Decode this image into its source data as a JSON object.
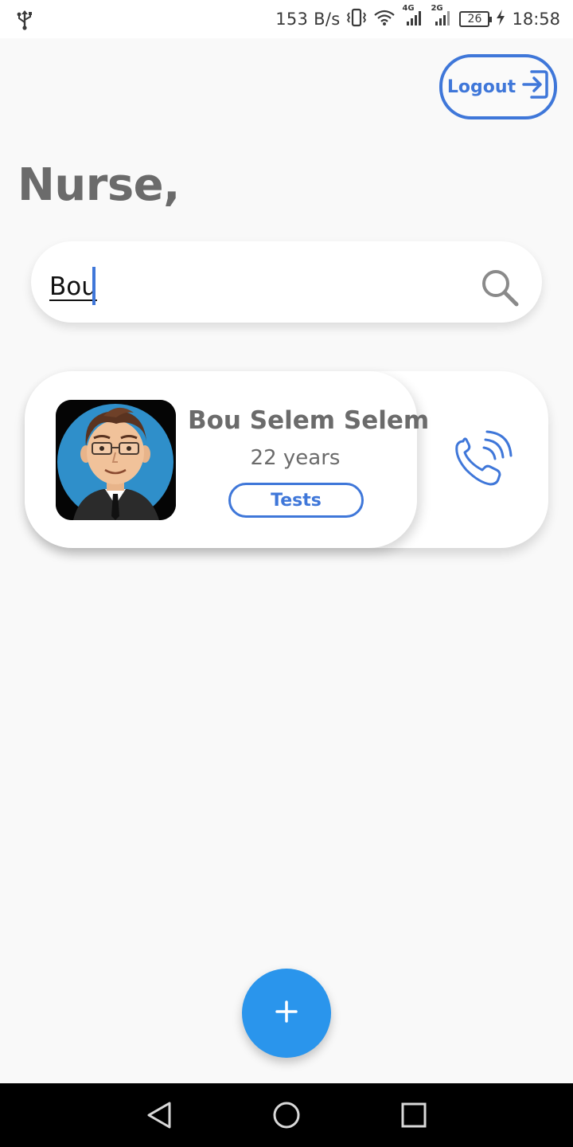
{
  "status_bar": {
    "net_speed": "153 B/s",
    "network_1": "4G",
    "network_2": "2G",
    "battery": "26",
    "time": "18:58",
    "icons": [
      "usb-icon",
      "vibrate-icon",
      "wifi-icon",
      "signal-icon",
      "signal-icon",
      "battery-icon",
      "charging-icon"
    ]
  },
  "header": {
    "logout_label": "Logout",
    "greeting": "Nurse,"
  },
  "search": {
    "value": "Bou"
  },
  "patients": [
    {
      "name": "Bou Selem Selem",
      "age": "22 years",
      "tests_label": "Tests"
    }
  ],
  "fab": {
    "label": "+"
  },
  "colors": {
    "accent": "#3f77d9",
    "fab": "#2a95ec",
    "text_gray": "#6b6b6b",
    "background": "#f9f9f9"
  }
}
